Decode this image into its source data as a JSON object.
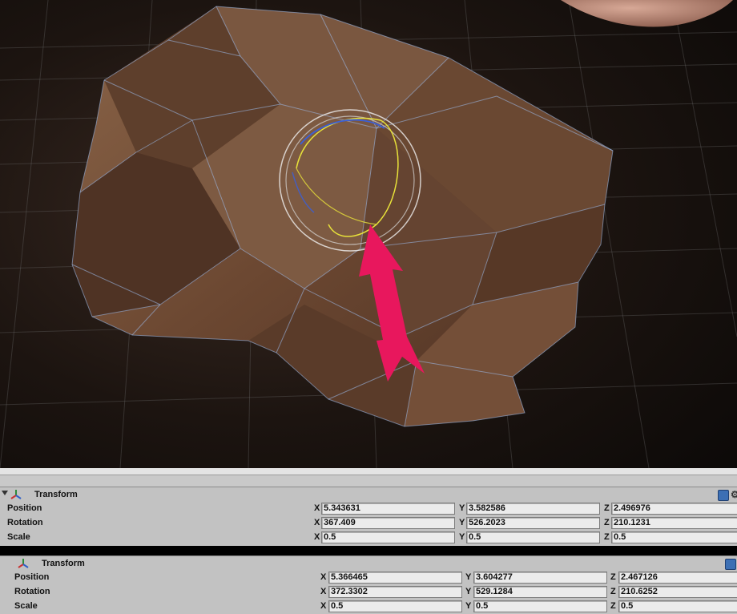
{
  "top_panel": {
    "title": "Transform",
    "rows": [
      {
        "label": "Position",
        "x": "5.343631",
        "y": "3.582586",
        "z": "2.496976"
      },
      {
        "label": "Rotation",
        "x": "367.409",
        "y": "526.2023",
        "z": "210.1231"
      },
      {
        "label": "Scale",
        "x": "0.5",
        "y": "0.5",
        "z": "0.5"
      }
    ]
  },
  "bottom_panel": {
    "title": "Transform",
    "rows": [
      {
        "label": "Position",
        "x": "5.366465",
        "y": "3.604277",
        "z": "2.467126"
      },
      {
        "label": "Rotation",
        "x": "372.3302",
        "y": "529.1284",
        "z": "210.6252"
      },
      {
        "label": "Scale",
        "x": "0.5",
        "y": "0.5",
        "z": "0.5"
      }
    ]
  },
  "axis_letters": {
    "x": "X",
    "y": "Y",
    "z": "Z"
  },
  "icons": {
    "fold": "triangle-down-icon",
    "transform": "transform-axes-icon",
    "help": "help-book-icon",
    "gear": "gear-icon"
  },
  "colors": {
    "rock": "#6e4a33",
    "arrow": "#e8175d",
    "gizmo_yellow": "#e8e23a",
    "gizmo_blue": "#3a5fd8",
    "panel_bg": "#c2c2c2",
    "field_bg": "#ebebeb"
  }
}
